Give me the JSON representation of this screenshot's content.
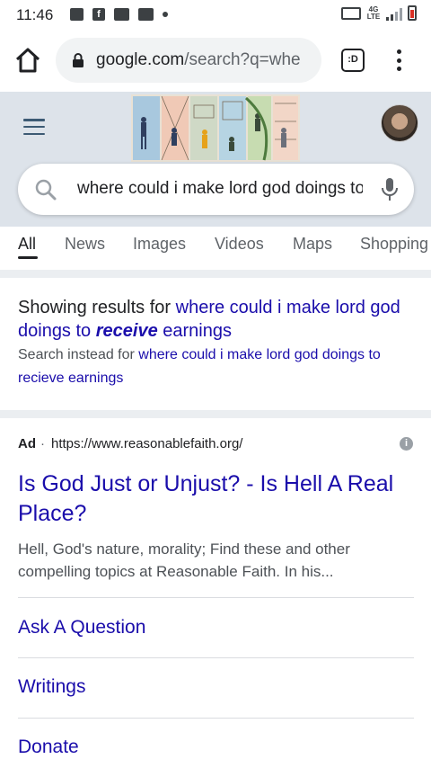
{
  "status_bar": {
    "time": "11:46",
    "left_icons": [
      "photo-icon",
      "facebook-icon",
      "message-icon",
      "news-icon",
      "dot-icon"
    ],
    "network": "4G LTE",
    "right_icons": [
      "vibrate-icon",
      "signal-icon",
      "battery-icon"
    ],
    "battery_color": "#d93025"
  },
  "browser": {
    "url_domain": "google.com",
    "url_path": "/search?q=whe",
    "tabs_label": ":D"
  },
  "header": {
    "search_query": "where could i make lord god doings to receive earnings"
  },
  "tabs": [
    {
      "label": "All"
    },
    {
      "label": "News"
    },
    {
      "label": "Images"
    },
    {
      "label": "Videos"
    },
    {
      "label": "Maps"
    },
    {
      "label": "Shopping"
    }
  ],
  "correction": {
    "showing_prefix": "Showing results for ",
    "corrected_part1": "where could i make lord god",
    "corrected_part2_pre": "doings to ",
    "corrected_bold": "receive",
    "corrected_post": " earnings",
    "instead_prefix": "Search instead for ",
    "instead_link": "where could i make lord god doings to recieve earnings"
  },
  "ad": {
    "label": "Ad",
    "separator": "·",
    "url": "https://www.reasonablefaith.org/",
    "title": "Is God Just or Unjust? - Is Hell A Real Place?",
    "description": "Hell, God's nature, morality; Find these and other compelling topics at Reasonable Faith. In his...",
    "sitelinks": [
      "Ask A Question",
      "Writings",
      "Donate"
    ]
  },
  "colors": {
    "link": "#1a0dab",
    "header_bg": "#dde3ea",
    "text": "#202124",
    "muted": "#5f6368"
  }
}
